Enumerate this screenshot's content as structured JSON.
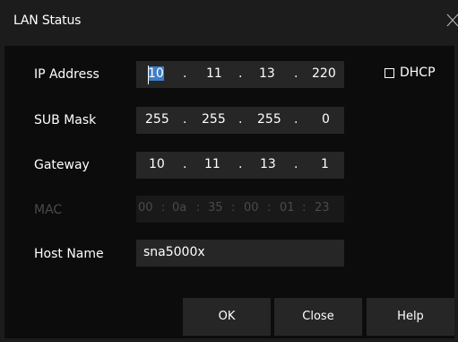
{
  "dialog": {
    "title": "LAN Status",
    "close_icon": "close-icon"
  },
  "fields": {
    "ip": {
      "label": "IP Address",
      "octets": [
        "10",
        "11",
        "13",
        "220"
      ]
    },
    "mask": {
      "label": "SUB Mask",
      "octets": [
        "255",
        "255",
        "255",
        "0"
      ]
    },
    "gateway": {
      "label": "Gateway",
      "octets": [
        "10",
        "11",
        "13",
        "1"
      ]
    },
    "mac": {
      "label": "MAC",
      "octets": [
        "00",
        "0a",
        "35",
        "00",
        "01",
        "23"
      ],
      "enabled": false
    },
    "hostname": {
      "label": "Host Name",
      "value": "sna5000x"
    }
  },
  "dhcp": {
    "label": "DHCP",
    "checked": false
  },
  "buttons": {
    "ok": "OK",
    "close": "Close",
    "help": "Help"
  },
  "colors": {
    "dialog_bg": "#1c1c1c",
    "panel_bg": "#0c0c0c",
    "field_bg": "#262626",
    "selection": "#3d7ec9",
    "disabled_text": "#4a4a4a"
  }
}
